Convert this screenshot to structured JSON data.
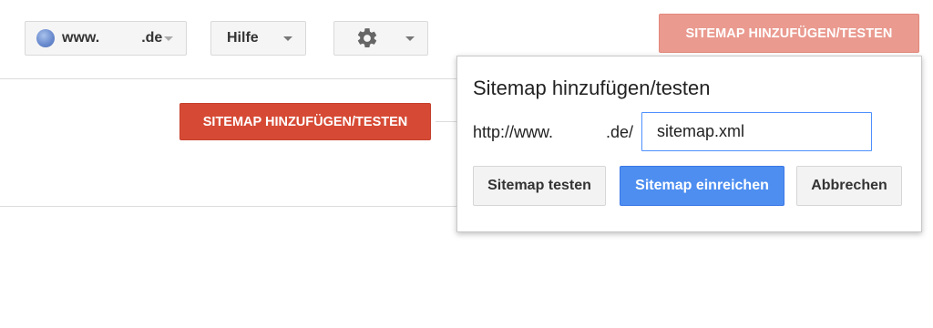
{
  "toolbar": {
    "site_domain": "www.",
    "site_tld": ".de",
    "help_label": "Hilfe",
    "settings_icon": "gear-icon",
    "site_icon": "globe-icon"
  },
  "top_add_button": "SITEMAP HINZUFÜGEN/TESTEN",
  "main_add_button": "SITEMAP HINZUFÜGEN/TESTEN",
  "dialog": {
    "title": "Sitemap hinzufügen/testen",
    "url_prefix": "http://www.",
    "url_suffix": ".de/",
    "input_value": "sitemap.xml",
    "test_button": "Sitemap testen",
    "submit_button": "Sitemap einreichen",
    "cancel_button": "Abbrechen"
  },
  "colors": {
    "primary_red": "#d64a35",
    "faded_red": "#ea9a8f",
    "primary_blue": "#4d8ef0",
    "input_focus_border": "#4d90fe"
  }
}
